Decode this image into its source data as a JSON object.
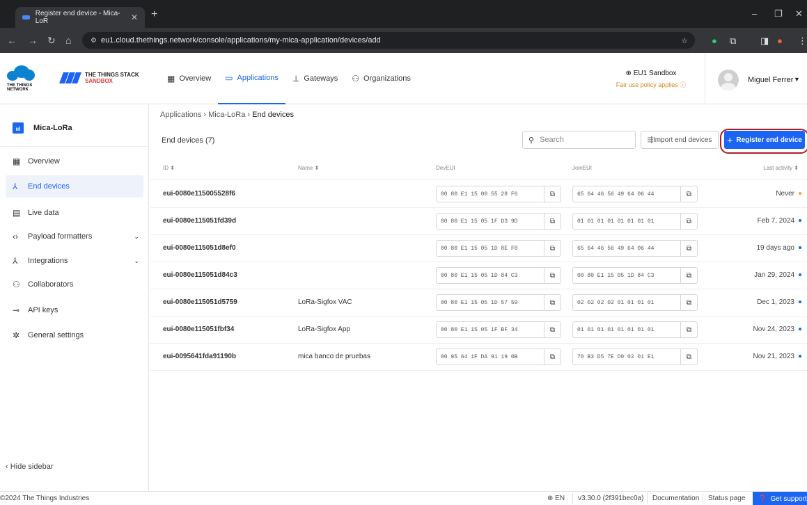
{
  "browser": {
    "tab_title": "Register end device - Mica-LoR",
    "tab_close": "✕",
    "new_tab": "+",
    "url": "eu1.cloud.thethings.network/console/applications/my-mica-application/devices/add",
    "icons": [
      "back-icon",
      "forward-icon",
      "reload-icon",
      "home-icon",
      "star-icon",
      "extensions-icon",
      "sidebar-icon",
      "profile-icon",
      "menu-icon"
    ]
  },
  "header": {
    "ttn_logo_text": "THE THINGS NETWORK",
    "tts_line1": "THE THINGS STACK",
    "tts_line2": "SANDBOX",
    "nav": [
      {
        "label": "Overview",
        "icon": "grid-icon"
      },
      {
        "label": "Applications",
        "icon": "applications-icon"
      },
      {
        "label": "Gateways",
        "icon": "gateway-icon"
      },
      {
        "label": "Organizations",
        "icon": "organizations-icon"
      }
    ],
    "cluster_name": "EU1 Sandbox",
    "cluster_note": "Fair use policy applies",
    "user_name": "Miguel Ferrer"
  },
  "sidebar": {
    "app_name": "Mica-LoRa",
    "items": [
      {
        "label": "Overview",
        "icon": "grid-icon"
      },
      {
        "label": "End devices",
        "icon": "end-devices-icon"
      },
      {
        "label": "Live data",
        "icon": "live-data-icon"
      },
      {
        "label": "Payload formatters",
        "icon": "code-icon"
      },
      {
        "label": "Integrations",
        "icon": "integrations-icon"
      },
      {
        "label": "Collaborators",
        "icon": "collaborators-icon"
      },
      {
        "label": "API keys",
        "icon": "key-icon"
      },
      {
        "label": "General settings",
        "icon": "gear-icon"
      }
    ],
    "hide_label": "Hide sidebar"
  },
  "breadcrumb": [
    "Applications",
    "Mica-LoRa",
    "End devices"
  ],
  "list": {
    "title": "End devices (7)",
    "search_placeholder": "Search",
    "import_label": "Import end devices",
    "register_label": "Register end device",
    "columns": [
      "ID",
      "Name",
      "DevEUI",
      "JoinEUI",
      "Last activity"
    ],
    "rows": [
      {
        "id": "eui-0080e115005528f6",
        "name": "",
        "dev_eui": "00 80 E1 15 00 55 28 F6",
        "join_eui": "65 64 46 56 49 64 06 44",
        "activity": "Never",
        "status": "orange"
      },
      {
        "id": "eui-0080e115051fd39d",
        "name": "",
        "dev_eui": "00 80 E1 15 05 1F D3 9D",
        "join_eui": "01 01 01 01 01 01 01 01",
        "activity": "Feb 7, 2024",
        "status": "blue"
      },
      {
        "id": "eui-0080e115051d8ef0",
        "name": "",
        "dev_eui": "00 80 E1 15 05 1D 8E F0",
        "join_eui": "65 64 46 56 49 64 06 44",
        "activity": "19 days ago",
        "status": "blue"
      },
      {
        "id": "eui-0080e115051d84c3",
        "name": "",
        "dev_eui": "00 80 E1 15 05 1D 84 C3",
        "join_eui": "00 80 E1 15 05 1D 84 C3",
        "activity": "Jan 29, 2024",
        "status": "blue"
      },
      {
        "id": "eui-0080e115051d5759",
        "name": "LoRa-Sigfox VAC",
        "dev_eui": "00 80 E1 15 05 1D 57 59",
        "join_eui": "02 02 02 02 01 01 01 01",
        "activity": "Dec 1, 2023",
        "status": "blue"
      },
      {
        "id": "eui-0080e115051fbf34",
        "name": "LoRa-Sigfox App",
        "dev_eui": "00 80 E1 15 05 1F BF 34",
        "join_eui": "01 01 01 01 01 01 01 01",
        "activity": "Nov 24, 2023",
        "status": "blue"
      },
      {
        "id": "eui-0095641fda91190b",
        "name": "mica banco de pruebas",
        "dev_eui": "00 95 64 1F DA 91 19 0B",
        "join_eui": "70 B3 D5 7E D0 02 01 E1",
        "activity": "Nov 21, 2023",
        "status": "blue"
      }
    ]
  },
  "footer": {
    "copyright": "2024 The Things Industries",
    "language": "EN",
    "version": "v3.30.0 (2f391bec0a)",
    "documentation": "Documentation",
    "status_page": "Status page",
    "support": "Get support"
  },
  "colors": {
    "accent": "#1c64f2",
    "highlight_ring": "#b01c2a",
    "never_dot": "#f5a623",
    "active_dot": "#1c64f2",
    "sandbox_red": "#e93b3b"
  }
}
